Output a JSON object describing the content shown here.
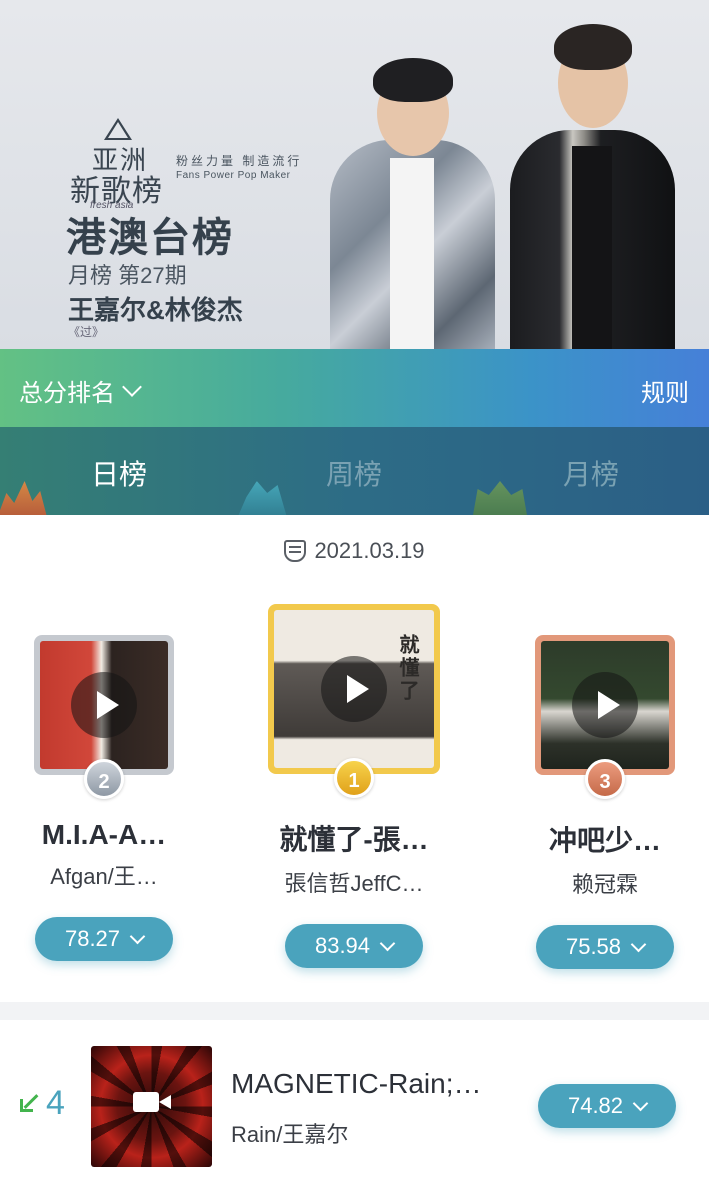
{
  "banner": {
    "logo_line1": "亚洲",
    "logo_line2": "新歌榜",
    "logo_sub": "fresh asia",
    "slogan_cn": "粉丝力量 制造流行",
    "slogan_en": "Fans Power   Pop Maker",
    "chart_name": "港澳台榜",
    "period": "月榜 第27期",
    "artists": "王嘉尔&林俊杰",
    "song": "《过》"
  },
  "rank_bar": {
    "sort_label": "总分排名",
    "rules_label": "规则"
  },
  "tabs": [
    {
      "label": "日榜",
      "active": true
    },
    {
      "label": "周榜",
      "active": false
    },
    {
      "label": "月榜",
      "active": false
    }
  ],
  "date": "2021.03.19",
  "podium": [
    {
      "rank": "2",
      "title": "M.I.A-A…",
      "artist": "Afgan/王…",
      "score": "78.27"
    },
    {
      "rank": "1",
      "title": "就懂了-張…",
      "artist": "張信哲JeffC…",
      "score": "83.94",
      "cover_text": "就懂了"
    },
    {
      "rank": "3",
      "title": "冲吧少…",
      "artist": "赖冠霖",
      "score": "75.58"
    }
  ],
  "list": [
    {
      "rank": "4",
      "trend": "down",
      "title": "MAGNETIC-Rain;…",
      "artist": "Rain/王嘉尔",
      "score": "74.82"
    }
  ],
  "colors": {
    "accent": "#4aa3bd",
    "gold": "#f2c94c",
    "silver": "#c5c9cf",
    "bronze": "#e2987a",
    "trend_down": "#43b44d"
  }
}
